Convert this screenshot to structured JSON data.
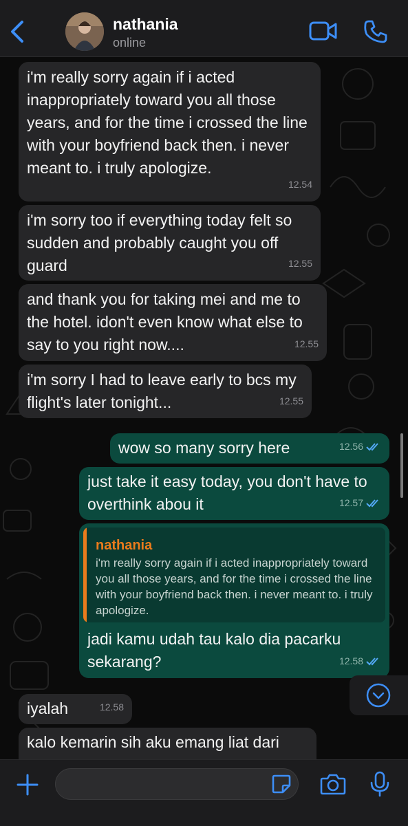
{
  "header": {
    "contact_name": "nathania",
    "status": "online",
    "icons": [
      "chevron-left-icon",
      "avatar",
      "video-camera-icon",
      "phone-icon"
    ]
  },
  "messages": [
    {
      "direction": "in",
      "text": "i'm really sorry again if i acted inappropriately toward you all those years, and for the time i crossed the line with your boyfriend back then. i never meant to. i truly apologize.",
      "time": "12.54"
    },
    {
      "direction": "in",
      "text": "i'm sorry too if everything today felt so sudden and probably caught you off guard",
      "time": "12.55"
    },
    {
      "direction": "in",
      "text": "and thank you for taking mei and me to the hotel. idon't even know what else to say to you right now....",
      "time": "12.55"
    },
    {
      "direction": "in",
      "text": "i'm sorry I had to leave early to bcs my flight's later tonight...",
      "time": "12.55"
    },
    {
      "direction": "out",
      "text": "wow so many sorry here",
      "time": "12.56",
      "read": true
    },
    {
      "direction": "out",
      "text": "just take it easy today, you don't have to overthink abou it",
      "time": "12.57",
      "read": true
    },
    {
      "direction": "out",
      "text": "jadi kamu udah tau kalo dia pacarku sekarang?",
      "time": "12.58",
      "read": true,
      "quote": {
        "name": "nathania",
        "text": "i'm really sorry again if i acted inappropriately toward you all those years, and for the time i crossed the line with your boyfriend back then. i never meant to. i truly apologize."
      }
    },
    {
      "direction": "in",
      "text": "iyalah",
      "time": "12.58"
    },
    {
      "direction": "in",
      "text": "kalo kemarin sih aku emang liat dari",
      "time": ""
    }
  ],
  "input": {
    "placeholder": "",
    "value": ""
  },
  "colors": {
    "accent": "#3d8ef7",
    "incoming_bubble": "#262628",
    "outgoing_bubble": "#0b4a3e",
    "quote_name": "#ea7b1c",
    "read_check": "#53a8f5"
  }
}
